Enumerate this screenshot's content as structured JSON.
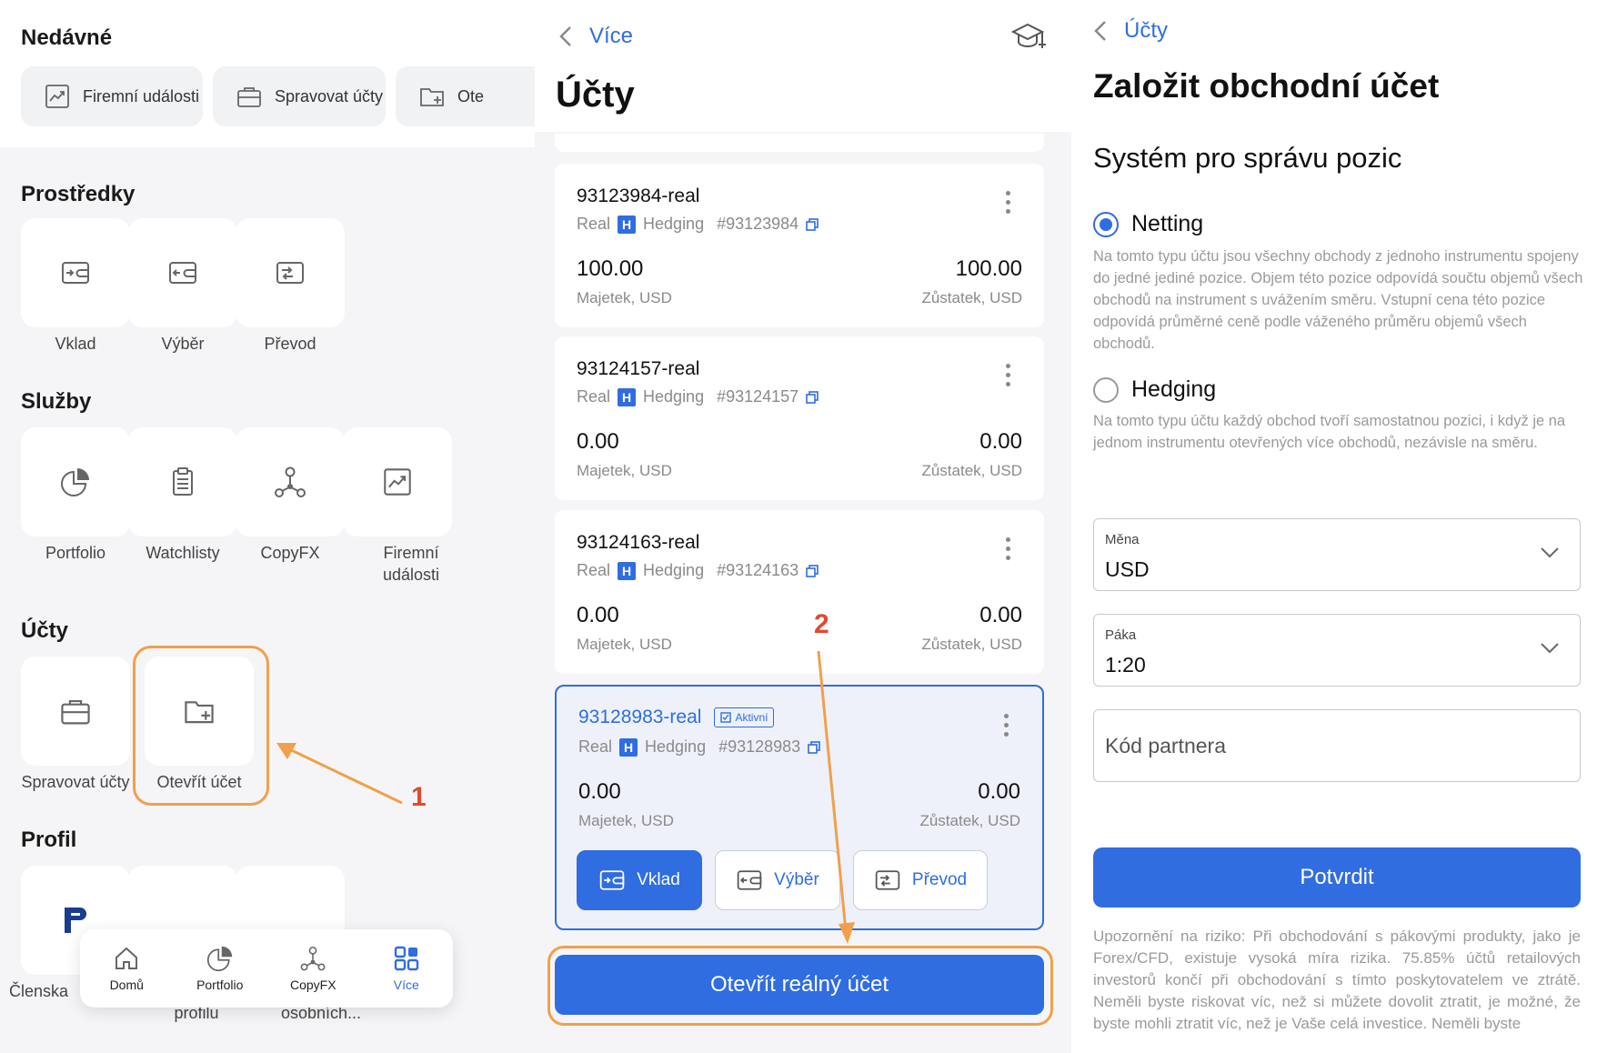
{
  "panel1": {
    "recent": {
      "title": "Nedávné",
      "chips": [
        "Firemní události",
        "Spravovat účty",
        "Ote"
      ]
    },
    "funds": {
      "title": "Prostředky",
      "items": [
        "Vklad",
        "Výběr",
        "Převod"
      ]
    },
    "services": {
      "title": "Služby",
      "items": [
        "Portfolio",
        "Watchlisty",
        "CopyFX",
        "Firemní události"
      ]
    },
    "accounts": {
      "title": "Účty",
      "items": [
        "Spravovat účty",
        "Otevřít účet"
      ]
    },
    "profile": {
      "title": "Profil",
      "items": [
        "Členska",
        "profilu",
        "osobních..."
      ]
    },
    "bottom_nav": [
      "Domů",
      "Portfolio",
      "CopyFX",
      "Více"
    ],
    "annotation": "1"
  },
  "panel2": {
    "back_label": "Více",
    "title": "Účty",
    "accounts": [
      {
        "name": "93123984-real",
        "type": "Real",
        "badge": "H",
        "mode": "Hedging",
        "number": "#93123984",
        "equity": "100.00",
        "equity_label": "Majetek, USD",
        "balance": "100.00",
        "balance_label": "Zůstatek, USD"
      },
      {
        "name": "93124157-real",
        "type": "Real",
        "badge": "H",
        "mode": "Hedging",
        "number": "#93124157",
        "equity": "0.00",
        "equity_label": "Majetek, USD",
        "balance": "0.00",
        "balance_label": "Zůstatek, USD"
      },
      {
        "name": "93124163-real",
        "type": "Real",
        "badge": "H",
        "mode": "Hedging",
        "number": "#93124163",
        "equity": "0.00",
        "equity_label": "Majetek, USD",
        "balance": "0.00",
        "balance_label": "Zůstatek, USD"
      },
      {
        "name": "93128983-real",
        "active_badge": "Aktivní",
        "type": "Real",
        "badge": "H",
        "mode": "Hedging",
        "number": "#93128983",
        "equity": "0.00",
        "equity_label": "Majetek, USD",
        "balance": "0.00",
        "balance_label": "Zůstatek, USD"
      }
    ],
    "actions": [
      "Vklad",
      "Výběr",
      "Převod"
    ],
    "open_real": "Otevřít reálný účet",
    "annotation": "2"
  },
  "panel3": {
    "back_label": "Účty",
    "title": "Založit obchodní účet",
    "subtitle": "Systém pro správu pozic",
    "netting": {
      "label": "Netting",
      "desc": "Na tomto typu účtu jsou všechny obchody z jednoho instrumentu spojeny do jedné jediné pozice. Objem této pozice odpovídá součtu objemů všech obchodů na instrument s uvážením směru. Vstupní cena této pozice odpovídá průměrné ceně podle váženého průměru objemů všech obchodů."
    },
    "hedging": {
      "label": "Hedging",
      "desc": "Na tomto typu účtu každý obchod tvoří samostatnou pozici, i když je na jednom instrumentu otevřených více obchodů, nezávisle na směru."
    },
    "currency": {
      "label": "Měna",
      "value": "USD"
    },
    "leverage": {
      "label": "Páka",
      "value": "1:20"
    },
    "partner": {
      "placeholder": "Kód partnera"
    },
    "confirm": "Potvrdit",
    "risk": "Upozornění na riziko: Při obchodování s pákovými produkty, jako je Forex/CFD, existuje vysoká míra rizika. 75.85% účtů retailových investorů končí při obchodování s tímto poskytovatelem ve ztrátě. Neměli byste riskovat víc, než si můžete dovolit ztratit, je možné, že byste mohli ztratit víc, než je Vaše celá investice. Neměli byste"
  },
  "colors": {
    "accent": "#2f6de1",
    "highlight": "#f0a04b",
    "annotation": "#e04a2e"
  }
}
